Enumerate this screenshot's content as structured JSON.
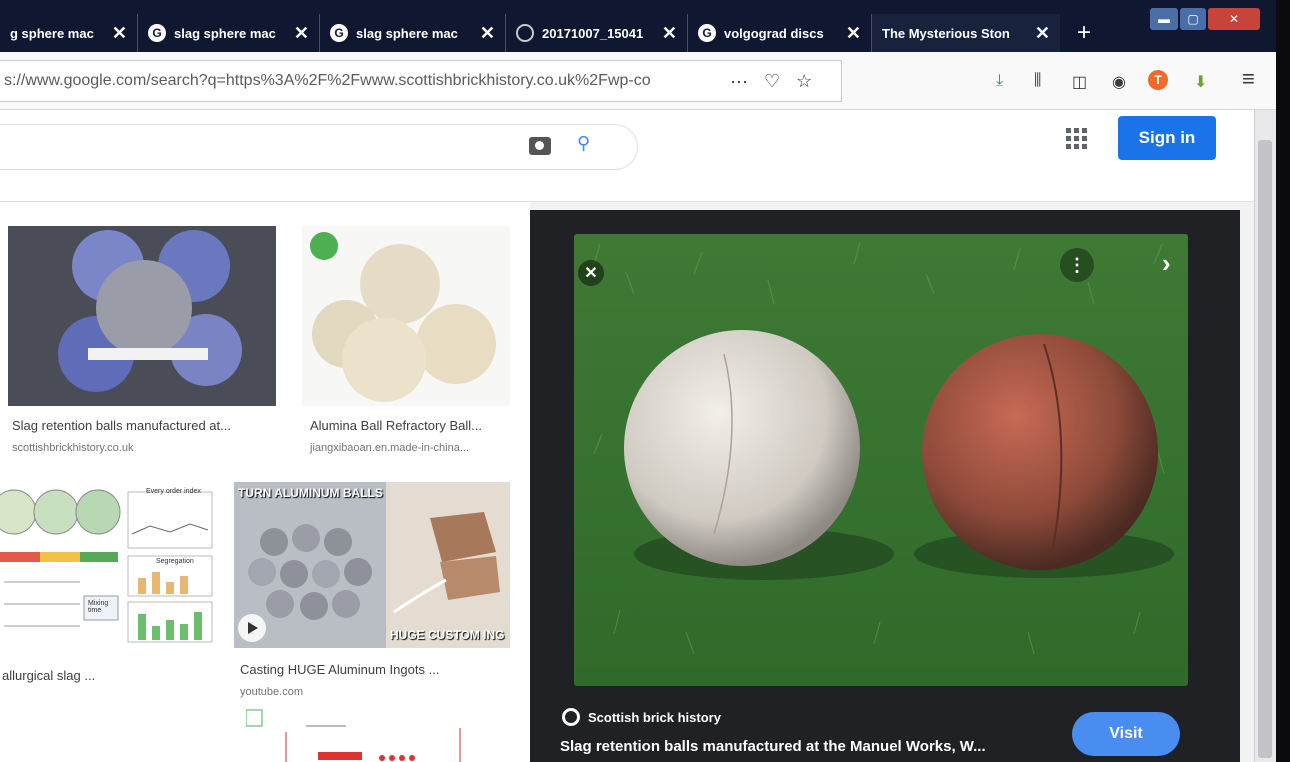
{
  "tabs": [
    {
      "label": "g sphere mac",
      "icon": "none"
    },
    {
      "label": "slag sphere mac",
      "icon": "google-icon"
    },
    {
      "label": "slag sphere mac",
      "icon": "google-icon"
    },
    {
      "label": "20171007_15041",
      "icon": "ring-icon"
    },
    {
      "label": "volgograd discs",
      "icon": "google-icon"
    },
    {
      "label": "The Mysterious Ston",
      "icon": "none"
    }
  ],
  "tab_close_glyph": "✕",
  "google_glyph": "G",
  "new_tab_glyph": "+",
  "address_bar": {
    "url": "s://www.google.com/search?q=https%3A%2F%2Fwww.scottishbrickhistory.co.uk%2Fwp-co",
    "more_glyph": "···",
    "pocket_glyph": "♡",
    "star_glyph": "☆"
  },
  "toolbar": {
    "download_glyph": "⤓",
    "library_glyph": "⫼",
    "sidebar_glyph": "◫",
    "account_glyph": "◉",
    "addon_glyph": "T",
    "arrow_glyph": "⬇",
    "menu_glyph": "≡"
  },
  "header": {
    "search_glyph": "⚲",
    "sign_in": "Sign in"
  },
  "results": [
    {
      "title": "Slag retention balls manufactured at...",
      "source": "scottishbrickhistory.co.uk"
    },
    {
      "title": "Alumina Ball Refractory Ball...",
      "source": "jiangxibaoan.en.made-in-china..."
    },
    {
      "title": "allurgical slag ...",
      "source": ""
    },
    {
      "title": "Casting HUGE Aluminum Ingots ...",
      "source": "youtube.com"
    }
  ],
  "chart_thumb": {
    "title": "Every order index",
    "segregation": "Segregation",
    "mixing_time": "Mixing time"
  },
  "video_thumb": {
    "top_text": "TURN ALUMINUM BALLS",
    "bottom_text": "HUGE CUSTOM ING"
  },
  "preview": {
    "close_glyph": "✕",
    "more_glyph": "⋮",
    "next_glyph": "›",
    "source": "Scottish brick history",
    "title": "Slag retention balls manufactured at the Manuel Works, W...",
    "visit": "Visit"
  },
  "colors": {
    "tab_bg": "#0f1830",
    "sign_in_bg": "#1a73e8",
    "visit_bg": "#4a8df0",
    "preview_bg": "#202124"
  }
}
